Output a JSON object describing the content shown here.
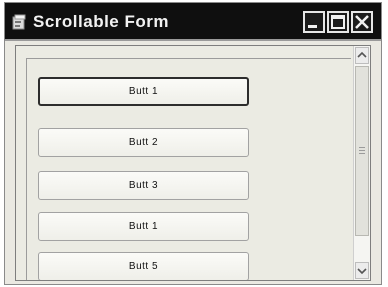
{
  "window": {
    "title": "Scrollable Form",
    "icon": "form-app-icon",
    "controls": [
      "minimize-icon",
      "maximize-icon",
      "close-icon"
    ]
  },
  "form": {
    "buttons": [
      {
        "label": "Butt   1"
      },
      {
        "label": "Butt   2"
      },
      {
        "label": "Butt  3"
      },
      {
        "label": "Butt   1"
      },
      {
        "label": "Butt   5"
      }
    ]
  },
  "scrollbar": {
    "up_icon": "scroll-up-arrow-icon",
    "down_icon": "scroll-down-arrow-icon"
  }
}
